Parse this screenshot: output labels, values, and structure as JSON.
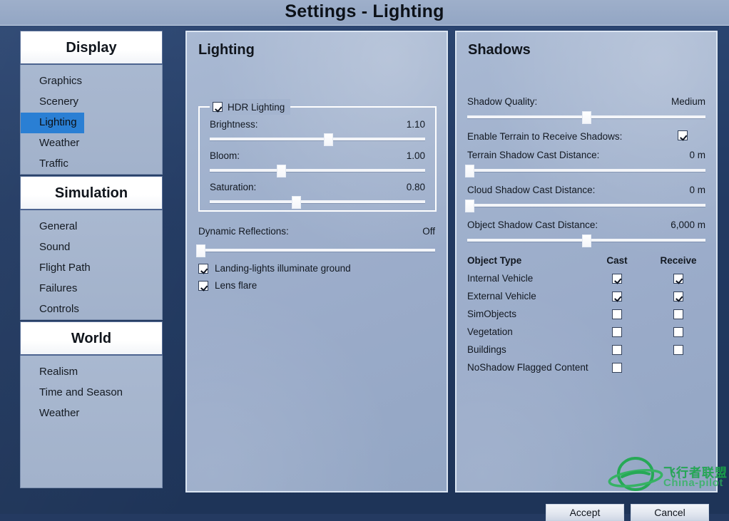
{
  "window": {
    "title": "Settings - Lighting"
  },
  "colors": {
    "accent_selected": "#2a7fd4",
    "outer_background": "#243a61",
    "panel_background": "#9fb0cc",
    "titlebar": "#96a9c6",
    "watermark_green": "#1aa94a"
  },
  "sidebar": {
    "groups": [
      {
        "header": "Display",
        "items": [
          {
            "label": "Graphics",
            "selected": false
          },
          {
            "label": "Scenery",
            "selected": false
          },
          {
            "label": "Lighting",
            "selected": true
          },
          {
            "label": "Weather",
            "selected": false
          },
          {
            "label": "Traffic",
            "selected": false
          }
        ]
      },
      {
        "header": "Simulation",
        "items": [
          {
            "label": "General",
            "selected": false
          },
          {
            "label": "Sound",
            "selected": false
          },
          {
            "label": "Flight Path",
            "selected": false
          },
          {
            "label": "Failures",
            "selected": false
          },
          {
            "label": "Controls",
            "selected": false
          }
        ]
      },
      {
        "header": "World",
        "items": [
          {
            "label": "Realism",
            "selected": false
          },
          {
            "label": "Time and Season",
            "selected": false
          },
          {
            "label": "Weather",
            "selected": false
          }
        ]
      }
    ]
  },
  "lighting_panel": {
    "title": "Lighting",
    "hdr_group": {
      "legend": "HDR Lighting",
      "checked": true,
      "sliders": [
        {
          "label": "Brightness:",
          "value": "1.10",
          "percent": 55
        },
        {
          "label": "Bloom:",
          "value": "1.00",
          "percent": 33
        },
        {
          "label": "Saturation:",
          "value": "0.80",
          "percent": 40
        }
      ]
    },
    "dynamic_reflections": {
      "label": "Dynamic Reflections:",
      "value": "Off",
      "percent": 1
    },
    "checkboxes": [
      {
        "label": "Landing-lights illuminate ground",
        "checked": true
      },
      {
        "label": "Lens flare",
        "checked": true
      }
    ]
  },
  "shadows_panel": {
    "title": "Shadows",
    "shadow_quality": {
      "label": "Shadow Quality:",
      "value": "Medium",
      "percent": 50
    },
    "enable_terrain_receive": {
      "label": "Enable Terrain to Receive Shadows:",
      "checked": true
    },
    "distance_sliders": [
      {
        "label": "Terrain Shadow Cast Distance:",
        "value": "0 m",
        "percent": 1
      },
      {
        "label": "Cloud Shadow Cast Distance:",
        "value": "0 m",
        "percent": 1
      },
      {
        "label": "Object Shadow Cast Distance:",
        "value": "6,000 m",
        "percent": 50
      }
    ],
    "table": {
      "headers": [
        "Object Type",
        "Cast",
        "Receive"
      ],
      "rows": [
        {
          "type": "Internal Vehicle",
          "cast": true,
          "receive": true,
          "has_receive": true
        },
        {
          "type": "External Vehicle",
          "cast": true,
          "receive": true,
          "has_receive": true
        },
        {
          "type": "SimObjects",
          "cast": false,
          "receive": false,
          "has_receive": true
        },
        {
          "type": "Vegetation",
          "cast": false,
          "receive": false,
          "has_receive": true
        },
        {
          "type": "Buildings",
          "cast": false,
          "receive": false,
          "has_receive": true
        },
        {
          "type": "NoShadow Flagged Content",
          "cast": false,
          "receive": false,
          "has_receive": false
        }
      ]
    }
  },
  "footer": {
    "ok_label": "Accept",
    "cancel_label": "Cancel"
  },
  "watermark": {
    "cn_text": "飞行者联盟",
    "en_text": "China-pilot"
  }
}
